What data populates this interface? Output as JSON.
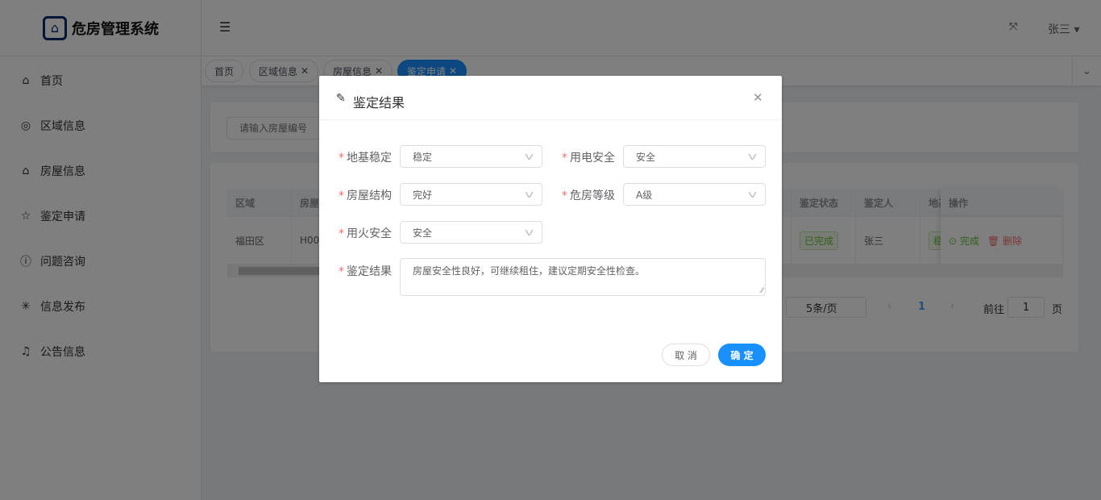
{
  "app": {
    "title": "危房管理系统",
    "user": "张三"
  },
  "sidebar": {
    "items": [
      {
        "label": "首页",
        "icon": "home-icon",
        "glyph": "⌂"
      },
      {
        "label": "区域信息",
        "icon": "location-icon",
        "glyph": "◎"
      },
      {
        "label": "房屋信息",
        "icon": "house-icon",
        "glyph": "⌂"
      },
      {
        "label": "鉴定申请",
        "icon": "star-icon",
        "glyph": "☆"
      },
      {
        "label": "问题咨询",
        "icon": "info-icon",
        "glyph": "ⓘ"
      },
      {
        "label": "信息发布",
        "icon": "loading-icon",
        "glyph": "✳"
      },
      {
        "label": "公告信息",
        "icon": "bell-icon",
        "glyph": "♫"
      }
    ]
  },
  "tabs": [
    {
      "label": "首页"
    },
    {
      "label": "区域信息"
    },
    {
      "label": "房屋信息"
    },
    {
      "label": "鉴定申请"
    }
  ],
  "search": {
    "placeholder": "请输入房屋编号"
  },
  "table": {
    "headers": [
      "区域",
      "房屋",
      "鉴定状态",
      "鉴定人",
      "地基",
      "操作"
    ],
    "row": {
      "region": "福田区",
      "house": "H00",
      "status": "已完成",
      "appraiser": "张三",
      "foundation": "稳",
      "complete": "完成",
      "delete": "删除"
    }
  },
  "pagination": {
    "page_size": "5条/页",
    "current": "1",
    "goto_label": "前往",
    "goto_value": "1",
    "page_suffix": "页"
  },
  "dialog": {
    "title": "鉴定结果",
    "fields": {
      "foundation": {
        "label": "地基稳定",
        "value": "稳定"
      },
      "electric": {
        "label": "用电安全",
        "value": "安全"
      },
      "structure": {
        "label": "房屋结构",
        "value": "完好"
      },
      "level": {
        "label": "危房等级",
        "value": "A级"
      },
      "fire": {
        "label": "用火安全",
        "value": "安全"
      },
      "result": {
        "label": "鉴定结果",
        "value": "房屋安全性良好，可继续租住，建议定期安全性检查。"
      }
    },
    "cancel": "取 消",
    "confirm": "确 定"
  }
}
